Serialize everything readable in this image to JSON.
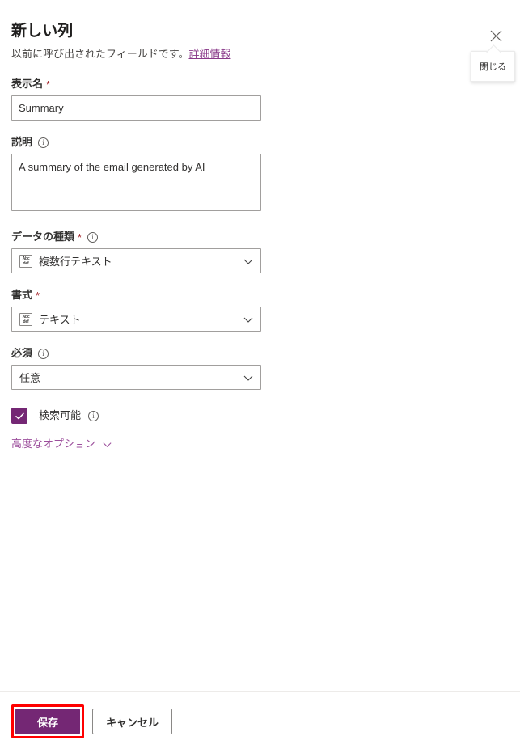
{
  "panel": {
    "title": "新しい列",
    "subtitle": "以前に呼び出されたフィールドです。",
    "subtitle_link": "詳細情報",
    "close_icon": "close-icon",
    "close_tooltip": "閉じる"
  },
  "fields": {
    "display_name": {
      "label": "表示名",
      "required_marker": "*",
      "value": "Summary",
      "placeholder": ""
    },
    "description": {
      "label": "説明",
      "info_icon": "ⓘ",
      "value": "A summary of the email generated by AI",
      "placeholder": ""
    },
    "data_type": {
      "label": "データの種類",
      "required_marker": "*",
      "info_icon": "ⓘ",
      "value": "複数行テキスト",
      "icon_top": "Abc",
      "icon_bottom": "def"
    },
    "format": {
      "label": "書式",
      "required_marker": "*",
      "value": "テキスト",
      "icon_top": "Abc",
      "icon_bottom": "def"
    },
    "required": {
      "label": "必須",
      "info_icon": "ⓘ",
      "value": "任意"
    },
    "searchable": {
      "label": "検索可能",
      "checked": true,
      "info_icon": "ⓘ"
    },
    "advanced": {
      "label": "高度なオプション"
    }
  },
  "footer": {
    "save_label": "保存",
    "cancel_label": "キャンセル"
  },
  "colors": {
    "brand_purple": "#742774",
    "link_purple": "#8a3a8a",
    "required_red": "#a4262c",
    "highlight_red": "#ff0000",
    "border_grey": "#a19f9d"
  }
}
